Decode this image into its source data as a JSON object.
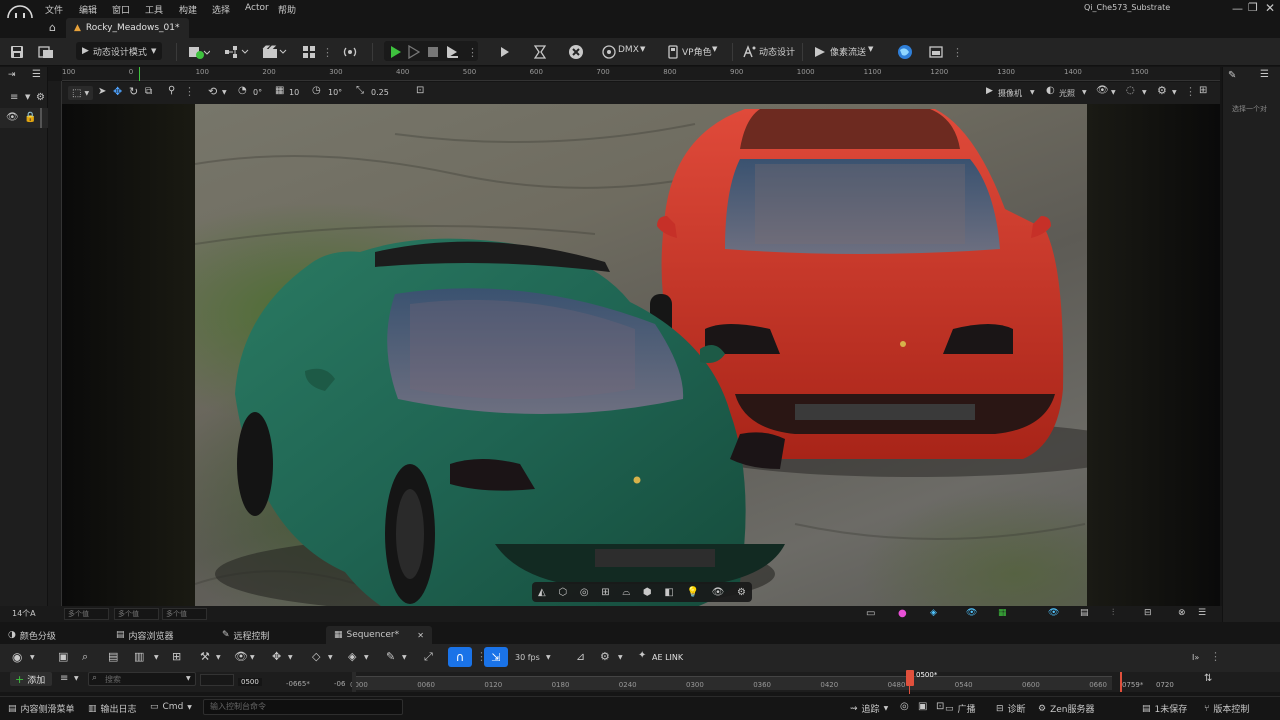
{
  "menu": {
    "items": [
      "文件",
      "编辑",
      "窗口",
      "工具",
      "构建",
      "选择",
      "Actor",
      "帮助"
    ],
    "project_name": "Qi_Che573_Substrate"
  },
  "tabs": {
    "level_tab": "Rocky_Meadows_01*"
  },
  "toolbar": {
    "mode_label": "动态设计模式",
    "dmx_label": "DMX",
    "vp_role_label": "VP角色",
    "motion_design_label": "动态设计",
    "pixel_stream_label": "像素流送"
  },
  "ruler": {
    "top_ticks": [
      "100",
      "0",
      "100",
      "200",
      "300",
      "400",
      "500",
      "600",
      "700",
      "800",
      "900",
      "1000",
      "1100",
      "1200",
      "1300",
      "1400",
      "1500"
    ]
  },
  "viewport_toolbar": {
    "rotation_snap": "0°",
    "grid_snap": "10",
    "angle_snap": "10°",
    "scale_snap": "0.25",
    "camera_label": "摄像机",
    "lighting_label": "光照"
  },
  "right_panel": {
    "hint": "选择一个对"
  },
  "status": {
    "selection_count": "14个A",
    "field_placeholder": "多个值"
  },
  "bottom_tabs": [
    "颜色分级",
    "内容浏览器",
    "远程控制",
    "Sequencer*"
  ],
  "sequencer": {
    "fps": "30 fps",
    "ae_link": "AE LINK",
    "add_label": "添加",
    "search_placeholder": "搜索",
    "current_frame": "0500",
    "playhead_label": "0500*",
    "range_start": "-0665*",
    "range_start2": "-06",
    "range_end": "0759*",
    "range_end2": "0720",
    "ticks": [
      "0000",
      "0060",
      "0120",
      "0180",
      "0240",
      "0300",
      "0360",
      "0420",
      "0480",
      "0540",
      "0600",
      "0660"
    ]
  },
  "footer": {
    "content_drawer": "内容侧滑菜单",
    "output_log": "输出日志",
    "cmd_label": "Cmd",
    "console_placeholder": "输入控制台命令",
    "trace_label": "追踪",
    "broadcast_label": "广播",
    "diagnostics_label": "诊断",
    "zen_label": "Zen服务器",
    "unsaved_label": "1未保存",
    "source_control_label": "版本控制"
  },
  "colors": {
    "accent_blue": "#1a73e8",
    "play_green": "#3ec23e",
    "playhead_red": "#e0503c",
    "green_car": "#1d5a46",
    "red_car": "#d23a2a"
  }
}
